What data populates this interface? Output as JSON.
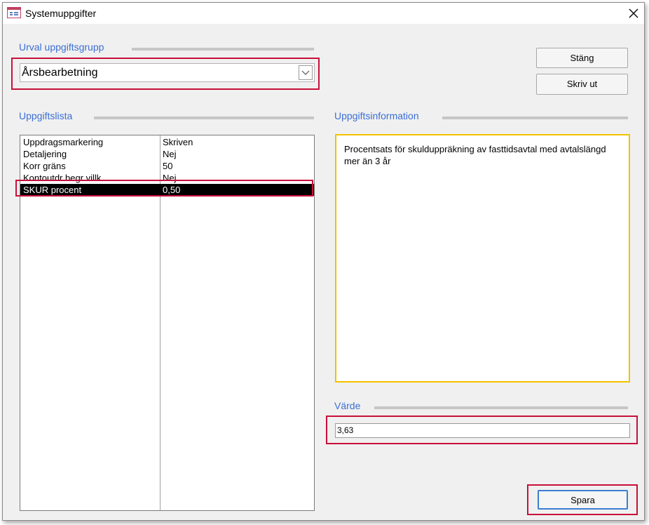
{
  "window": {
    "title": "Systemuppgifter",
    "icon": "form-icon"
  },
  "group_section": {
    "label": "Urval uppgiftsgrupp",
    "selected_value": "Årsbearbetning"
  },
  "buttons": {
    "close_label": "Stäng",
    "print_label": "Skriv ut",
    "save_label": "Spara"
  },
  "list_section": {
    "label": "Uppgiftslista",
    "rows": [
      {
        "name": "Uppdragsmarkering",
        "value": "Skriven"
      },
      {
        "name": "Detaljering",
        "value": "Nej"
      },
      {
        "name": "Korr gräns",
        "value": "50"
      },
      {
        "name": "Kontoutdr begr villk",
        "value": "Nej"
      },
      {
        "name": "SKUR procent",
        "value": "0,50"
      }
    ],
    "selected_index": 4
  },
  "info_section": {
    "label": "Uppgiftsinformation",
    "text": "Procentsats för skulduppräkning av fasttidsavtal med avtalslängd mer än 3 år"
  },
  "value_section": {
    "label": "Värde",
    "value": "3,63"
  },
  "colors": {
    "section_label": "#3b6fd4",
    "highlight_frame": "#c8103a",
    "info_border": "#f2c200",
    "selected_row_bg": "#000000"
  }
}
